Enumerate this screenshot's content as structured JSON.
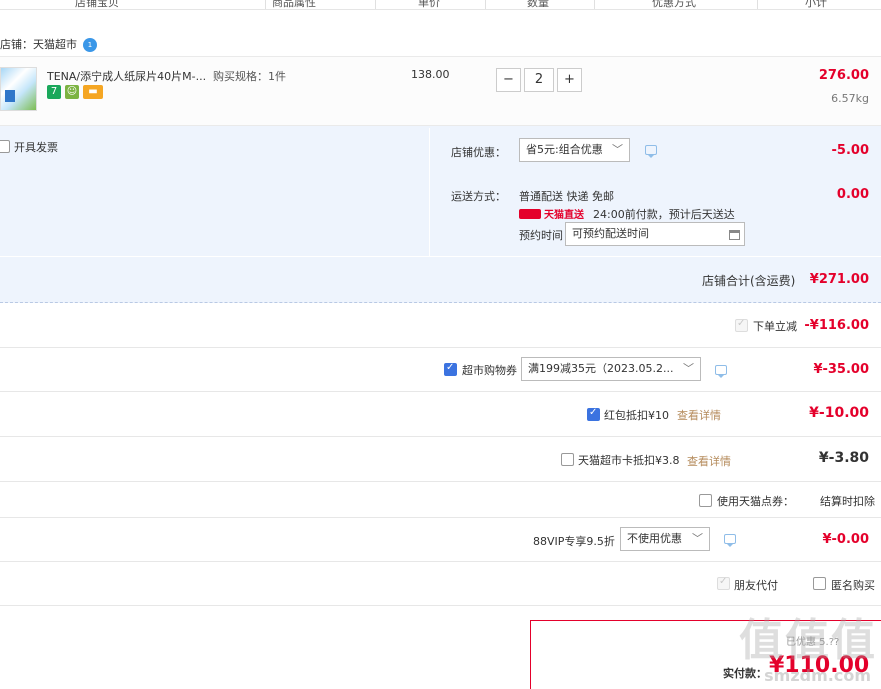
{
  "table_header": {
    "col_product": "店铺宝贝",
    "col_attr": "商品属性",
    "col_price": "单价",
    "col_qty": "数量",
    "col_discount": "优惠方式",
    "col_subtotal": "小计"
  },
  "shop": {
    "label": "店铺：天猫超市",
    "badge": "1"
  },
  "item": {
    "title": "TENA/添宁成人纸尿片40片M-...",
    "spec": "购买规格：1件",
    "price": "138.00",
    "quantity": "2",
    "minus": "−",
    "plus": "+",
    "subtotal": "276.00",
    "weight": "6.57kg",
    "tag_7": "7"
  },
  "invoice": {
    "label": "开具发票",
    "checked": false
  },
  "shop_discount": {
    "label": "店铺优惠：",
    "selected": "省5元:组合优惠",
    "amount": "-5.00"
  },
  "shipping": {
    "label": "运送方式：",
    "method": "普通配送 快递 免邮",
    "brand": "天猫直送",
    "delivery_note": "24:00前付款，预计后天送达",
    "appt_label": "预约时间",
    "appt_placeholder": "可预约配送时间",
    "amount": "0.00"
  },
  "shop_total": {
    "label": "店铺合计(含运费)",
    "amount": "¥271.00"
  },
  "instant_discount": {
    "label": "下单立减",
    "amount": "-¥116.00"
  },
  "supermarket_coupon": {
    "label": "超市购物券",
    "selected": "满199减35元（2023.05.2...",
    "amount": "¥-35.00"
  },
  "red_packet": {
    "label": "红包抵扣¥10",
    "link": "查看详情",
    "amount": "¥-10.00"
  },
  "mall_card": {
    "label": "天猫超市卡抵扣¥3.8",
    "link": "查看详情",
    "amount": "¥-3.80"
  },
  "points": {
    "label": "使用天猫点券：",
    "note": "结算时扣除"
  },
  "vip": {
    "label": "88VIP专享9.5折",
    "selected": "不使用优惠",
    "amount": "¥-0.00"
  },
  "friend_pay": {
    "label": "朋友代付"
  },
  "anonymous": {
    "label": "匿名购买"
  },
  "final": {
    "hint": "已优惠 5.??",
    "label": "实付款：",
    "amount": "¥110.00"
  },
  "watermark": {
    "main": "值值值",
    "sub": "smzdm.com"
  },
  "colors": {
    "accent_red": "#e4002b",
    "promo_bg": "#eef4fd",
    "checkbox_blue": "#3b73e0"
  },
  "icons": [
    "shop-badge-icon",
    "chevron-down-icon",
    "chat-icon",
    "calendar-icon",
    "tmall-logo-icon",
    "checkmark-icon"
  ]
}
